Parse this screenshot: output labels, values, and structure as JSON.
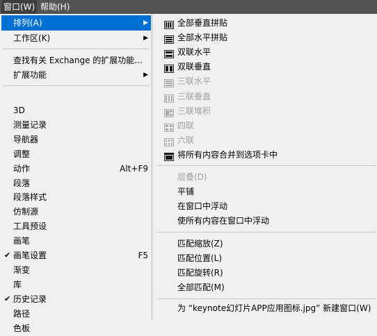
{
  "menubar": {
    "window": "窗口(W)",
    "help": "帮助(H)"
  },
  "main_menu": {
    "arrange": "排列(A)",
    "workspace": "工作区(K)",
    "find_exchange": "查找有关 Exchange 的扩展功能...",
    "extensions": "扩展功能",
    "items": [
      {
        "label": "3D"
      },
      {
        "label": "测量记录"
      },
      {
        "label": "导航器"
      },
      {
        "label": "调整"
      },
      {
        "label": "动作",
        "shortcut": "Alt+F9"
      },
      {
        "label": "段落"
      },
      {
        "label": "段落样式"
      },
      {
        "label": "仿制源"
      },
      {
        "label": "工具预设"
      },
      {
        "label": "画笔"
      },
      {
        "label": "画笔设置",
        "shortcut": "F5",
        "checked": true
      },
      {
        "label": "渐变"
      },
      {
        "label": "库"
      },
      {
        "label": "历史记录",
        "checked": true
      },
      {
        "label": "路径"
      },
      {
        "label": "色板"
      }
    ]
  },
  "arrange_menu": {
    "layouts": [
      {
        "label": "全部垂直拼贴",
        "icon": "tile-vertical-icon",
        "enabled": true
      },
      {
        "label": "全部水平拼贴",
        "icon": "tile-horizontal-icon",
        "enabled": true
      },
      {
        "label": "双联水平",
        "icon": "two-up-horizontal-icon",
        "enabled": true
      },
      {
        "label": "双联垂直",
        "icon": "two-up-vertical-icon",
        "enabled": true
      },
      {
        "label": "三联水平",
        "icon": "three-up-horizontal-icon",
        "enabled": false
      },
      {
        "label": "三联垂直",
        "icon": "three-up-vertical-icon",
        "enabled": false
      },
      {
        "label": "三联堆积",
        "icon": "three-up-stacked-icon",
        "enabled": false
      },
      {
        "label": "四联",
        "icon": "four-up-icon",
        "enabled": false
      },
      {
        "label": "六联",
        "icon": "six-up-icon",
        "enabled": false
      },
      {
        "label": "将所有内容合并到选项卡中",
        "icon": "consolidate-tabs-icon",
        "enabled": true
      }
    ],
    "cascade": "层叠(D)",
    "tile": "平铺",
    "float_in_window": "在窗口中浮动",
    "float_all": "使所有内容在窗口中浮动",
    "match_zoom": "匹配缩放(Z)",
    "match_location": "匹配位置(L)",
    "match_rotation": "匹配旋转(R)",
    "match_all": "全部匹配(M)",
    "new_window": "为 “keynote幻灯片APP应用图标.jpg” 新建窗口(W)",
    "colors": {
      "enabled_icon": "#1a1a1a",
      "disabled_icon": "#a8a8a8"
    }
  },
  "colors": {
    "highlight": "#0070d2",
    "menubar": "#535353",
    "menu_bg": "#f0f0f0"
  }
}
